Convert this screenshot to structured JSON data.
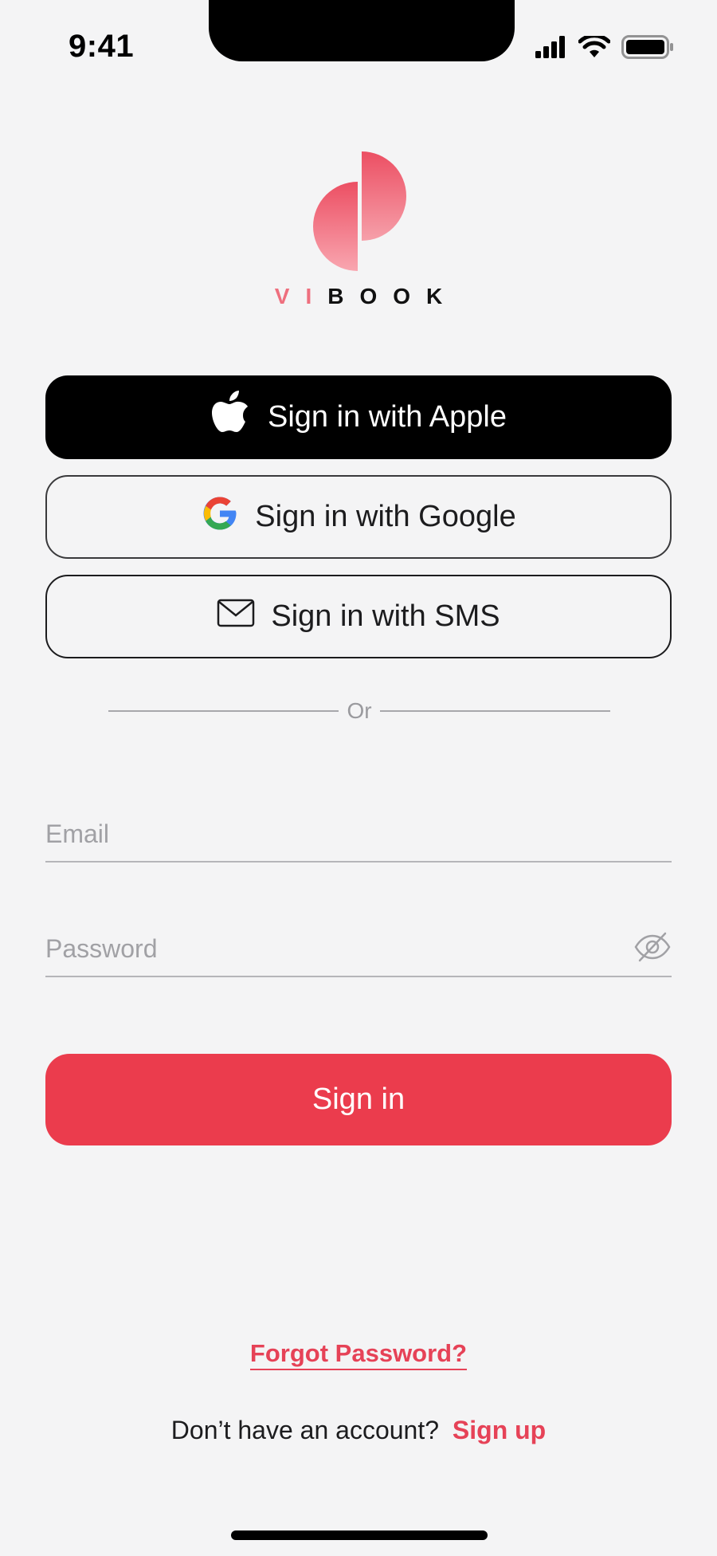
{
  "status_bar": {
    "time": "9:41",
    "icons": [
      "signal-icon",
      "wifi-icon",
      "battery-icon"
    ]
  },
  "brand": {
    "logo_icon": "vibook-logo-icon",
    "name_accent": "VI",
    "name_rest": "BOOK",
    "accent_color": "#ee6f7e"
  },
  "social_login": {
    "apple_label": "Sign in with Apple",
    "google_label": "Sign in with Google",
    "sms_label": "Sign in with SMS"
  },
  "divider": {
    "label": "Or"
  },
  "form": {
    "email_placeholder": "Email",
    "email_value": "",
    "password_placeholder": "Password",
    "password_value": "",
    "password_toggle_icon": "eye-off-icon"
  },
  "actions": {
    "signin_label": "Sign in",
    "forgot_label": "Forgot Password?",
    "no_account_text": "Don’t have an account?",
    "signup_label": "Sign up"
  },
  "colors": {
    "primary": "#eb3c4d",
    "link": "#e64257",
    "background": "#f4f4f5"
  }
}
